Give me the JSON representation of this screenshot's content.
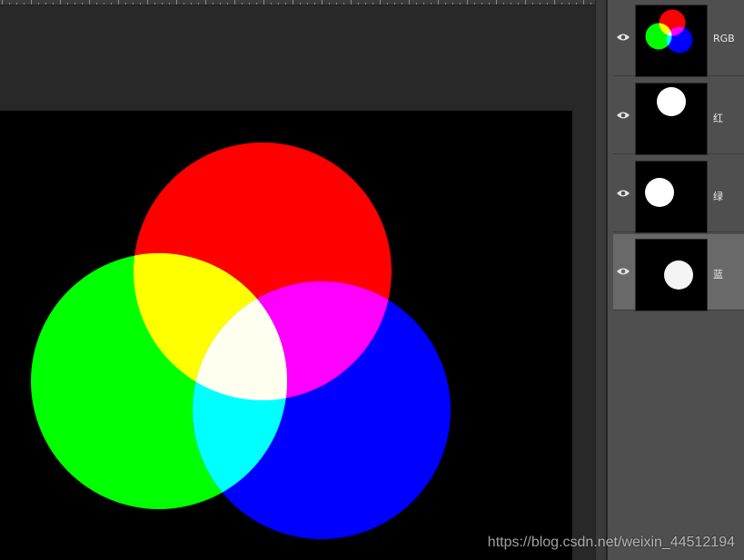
{
  "channels": [
    {
      "name": "RGB",
      "selected": false,
      "thumbnail": "composite"
    },
    {
      "name": "红",
      "selected": false,
      "thumbnail": "red-mask"
    },
    {
      "name": "绿",
      "selected": false,
      "thumbnail": "green-mask"
    },
    {
      "name": "蓝",
      "selected": true,
      "thumbnail": "blue-mask"
    }
  ],
  "canvas": {
    "background": "#000000",
    "circles": [
      {
        "name": "red-circle",
        "color": "#ff0000"
      },
      {
        "name": "green-circle",
        "color": "#00ff00"
      },
      {
        "name": "blue-circle",
        "color": "#0000ff"
      }
    ],
    "overlaps": {
      "red_green": "#ffff00",
      "red_blue": "#ff00ff",
      "green_blue": "#00ffff",
      "all": "#fffff0"
    }
  },
  "icons": {
    "visibility": "eye-icon"
  },
  "watermark": "https://blog.csdn.net/weixin_44512194"
}
